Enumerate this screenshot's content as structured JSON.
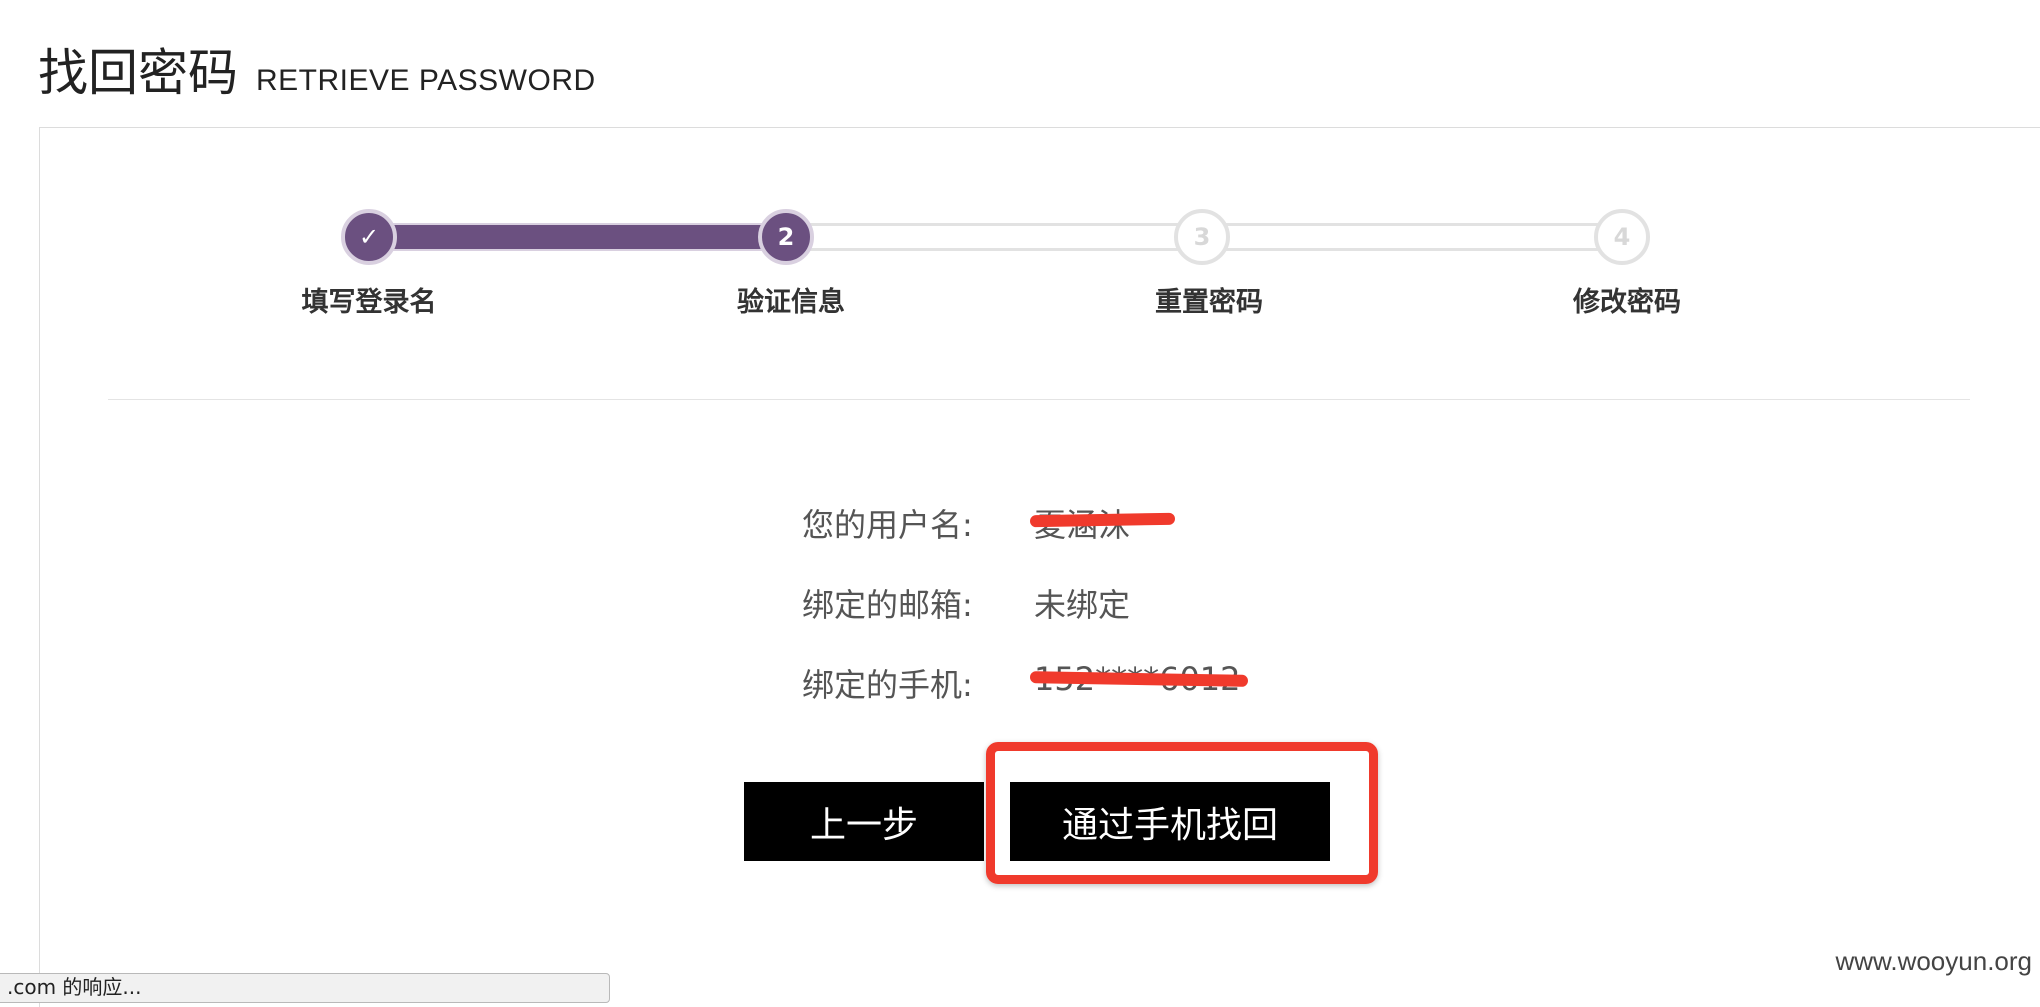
{
  "heading": {
    "title_cn": "找回密码",
    "title_en": "RETRIEVE PASSWORD"
  },
  "stepper": {
    "current_step": 2,
    "steps": [
      {
        "marker": "✓",
        "label": "填写登录名",
        "state": "done"
      },
      {
        "marker": "2",
        "label": "验证信息",
        "state": "current"
      },
      {
        "marker": "3",
        "label": "重置密码",
        "state": "todo"
      },
      {
        "marker": "4",
        "label": "修改密码",
        "state": "todo"
      }
    ],
    "active_color": "#6b5080",
    "inactive_color": "#e2e2e2"
  },
  "info": {
    "username_label": "您的用户名:",
    "username_value": "夏涵沫",
    "email_label": "绑定的邮箱:",
    "email_value": "未绑定",
    "phone_label": "绑定的手机:",
    "phone_value": "152****6012"
  },
  "actions": {
    "prev_label": "上一步",
    "phone_recover_label": "通过手机找回"
  },
  "annotation": {
    "redaction_color": "#f03a2c",
    "highlight_color": "#f03a2c"
  },
  "statusbar": {
    "text": ".com 的响应..."
  },
  "watermark": "www.wooyun.org"
}
